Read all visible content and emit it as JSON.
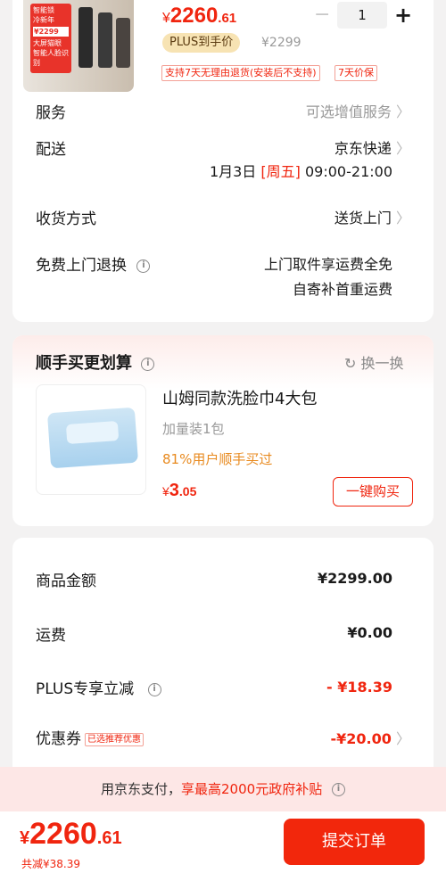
{
  "product": {
    "promo_lines": [
      "智能锁",
      "冷新年",
      "¥2299",
      "大屏猫眼",
      "智能人脸识别"
    ],
    "price_symbol": "¥",
    "price_int": "2260",
    "price_dec": ".61",
    "quantity": "1",
    "plus_badge": "PLUS到手价",
    "orig_price": "¥2299",
    "tag_return": "支持7天无理由退货(安装后不支持)",
    "tag_price_protect": "7天价保"
  },
  "rows": {
    "service_label": "服务",
    "service_value": "可选增值服务",
    "delivery_label": "配送",
    "delivery_value": "京东快递",
    "delivery_date": "1月3日",
    "delivery_weekday": "[周五]",
    "delivery_time": "09:00-21:00",
    "receive_label": "收货方式",
    "receive_value": "送货上门",
    "return_label": "免费上门退换",
    "return_value_1": "上门取件享运费全免",
    "return_value_2": "自寄补首重运费"
  },
  "addon": {
    "title": "顺手买更划算",
    "refresh_label": "换一换",
    "item_name": "山姆同款洗脸巾4大包",
    "item_spec": "加量装1包",
    "item_stat": "81%用户顺手买过",
    "item_price_symbol": "¥",
    "item_price_int": "3",
    "item_price_dec": ".05",
    "buy_label": "一键购买"
  },
  "summary": {
    "goods_label": "商品金额",
    "goods_value": "¥2299.00",
    "freight_label": "运费",
    "freight_value": "¥0.00",
    "plus_label": "PLUS专享立减",
    "plus_value": "- ¥18.39",
    "coupon_label": "优惠券",
    "coupon_tag": "已选推荐优惠",
    "coupon_value": "-¥20.00"
  },
  "subsidy": {
    "text_prefix": "用京东支付，",
    "text_highlight": "享最高2000元政府补贴"
  },
  "footer": {
    "total_symbol": "¥",
    "total_int": "2260",
    "total_dec": ".61",
    "saved": "共减¥38.39",
    "submit_label": "提交订单"
  },
  "colors": {
    "accent": "#f0250f",
    "plus_gold": "#f7e3b3",
    "subsidy_bg": "#fde7e6",
    "addon_stat": "#e88a1f"
  }
}
